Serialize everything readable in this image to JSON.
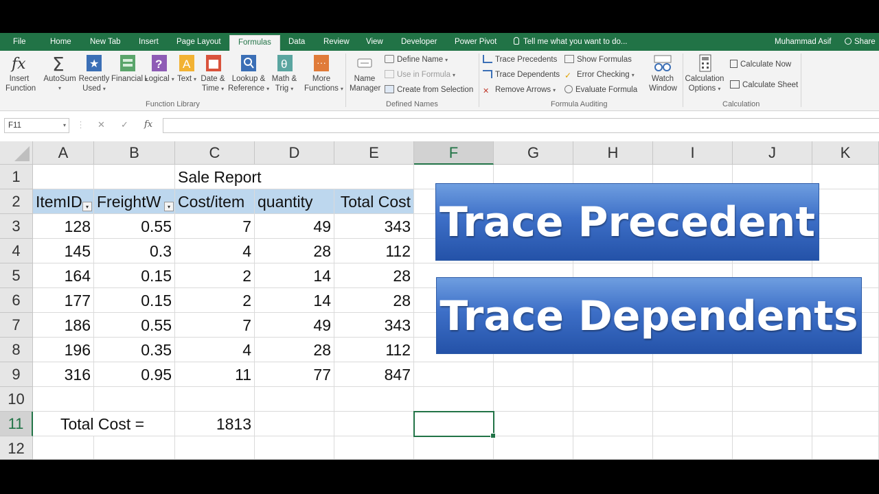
{
  "tabs": [
    {
      "label": "File"
    },
    {
      "label": "Home"
    },
    {
      "label": "New Tab"
    },
    {
      "label": "Insert"
    },
    {
      "label": "Page Layout"
    },
    {
      "label": "Formulas"
    },
    {
      "label": "Data"
    },
    {
      "label": "Review"
    },
    {
      "label": "View"
    },
    {
      "label": "Developer"
    },
    {
      "label": "Power Pivot"
    }
  ],
  "active_tab": "Formulas",
  "tell_me": "Tell me what you want to do...",
  "user_name": "Muhammad Asif",
  "share_label": "Share",
  "ribbon": {
    "function_library": {
      "label": "Function Library",
      "insert_function": "Insert Function",
      "autosum": "AutoSum",
      "recently_used": "Recently Used",
      "financial": "Financial",
      "logical": "Logical",
      "text": "Text",
      "date_time": "Date & Time",
      "lookup_reference": "Lookup & Reference",
      "math_trig": "Math & Trig",
      "more_functions": "More Functions"
    },
    "defined_names": {
      "label": "Defined Names",
      "name_manager": "Name Manager",
      "define_name": "Define Name",
      "use_in_formula": "Use in Formula",
      "create_from_selection": "Create from Selection"
    },
    "formula_auditing": {
      "label": "Formula Auditing",
      "trace_precedents": "Trace Precedents",
      "trace_dependents": "Trace Dependents",
      "remove_arrows": "Remove Arrows",
      "show_formulas": "Show Formulas",
      "error_checking": "Error Checking",
      "evaluate_formula": "Evaluate Formula",
      "watch_window": "Watch Window"
    },
    "calculation": {
      "label": "Calculation",
      "calculation_options": "Calculation Options",
      "calculate_now": "Calculate Now",
      "calculate_sheet": "Calculate Sheet"
    }
  },
  "formula_bar": {
    "name_box": "F11",
    "cancel": "✕",
    "enter": "✓",
    "fx": "fx",
    "formula": ""
  },
  "columns": [
    "A",
    "B",
    "C",
    "D",
    "E",
    "F",
    "G",
    "H",
    "I",
    "J",
    "K"
  ],
  "selected_column": "F",
  "rows": [
    "1",
    "2",
    "3",
    "4",
    "5",
    "6",
    "7",
    "8",
    "9",
    "10",
    "11",
    "12"
  ],
  "selected_row": "11",
  "sheet": {
    "title": "Sale Report",
    "headers": [
      "ItemID",
      "FreightW",
      "Cost/item",
      "quantity",
      "Total Cost"
    ],
    "data": [
      [
        "128",
        "0.55",
        "7",
        "49",
        "343"
      ],
      [
        "145",
        "0.3",
        "4",
        "28",
        "112"
      ],
      [
        "164",
        "0.15",
        "2",
        "14",
        "28"
      ],
      [
        "177",
        "0.15",
        "2",
        "14",
        "28"
      ],
      [
        "186",
        "0.55",
        "7",
        "49",
        "343"
      ],
      [
        "196",
        "0.35",
        "4",
        "28",
        "112"
      ],
      [
        "316",
        "0.95",
        "11",
        "77",
        "847"
      ]
    ],
    "total_label": "Total Cost =",
    "total_value": "1813"
  },
  "banners": {
    "first": "Trace Precedent",
    "second": "Trace Dependents"
  },
  "colors": {
    "excel_green": "#217346",
    "header_fill": "#bdd7ee",
    "banner_blue": "#3d6fc7"
  }
}
